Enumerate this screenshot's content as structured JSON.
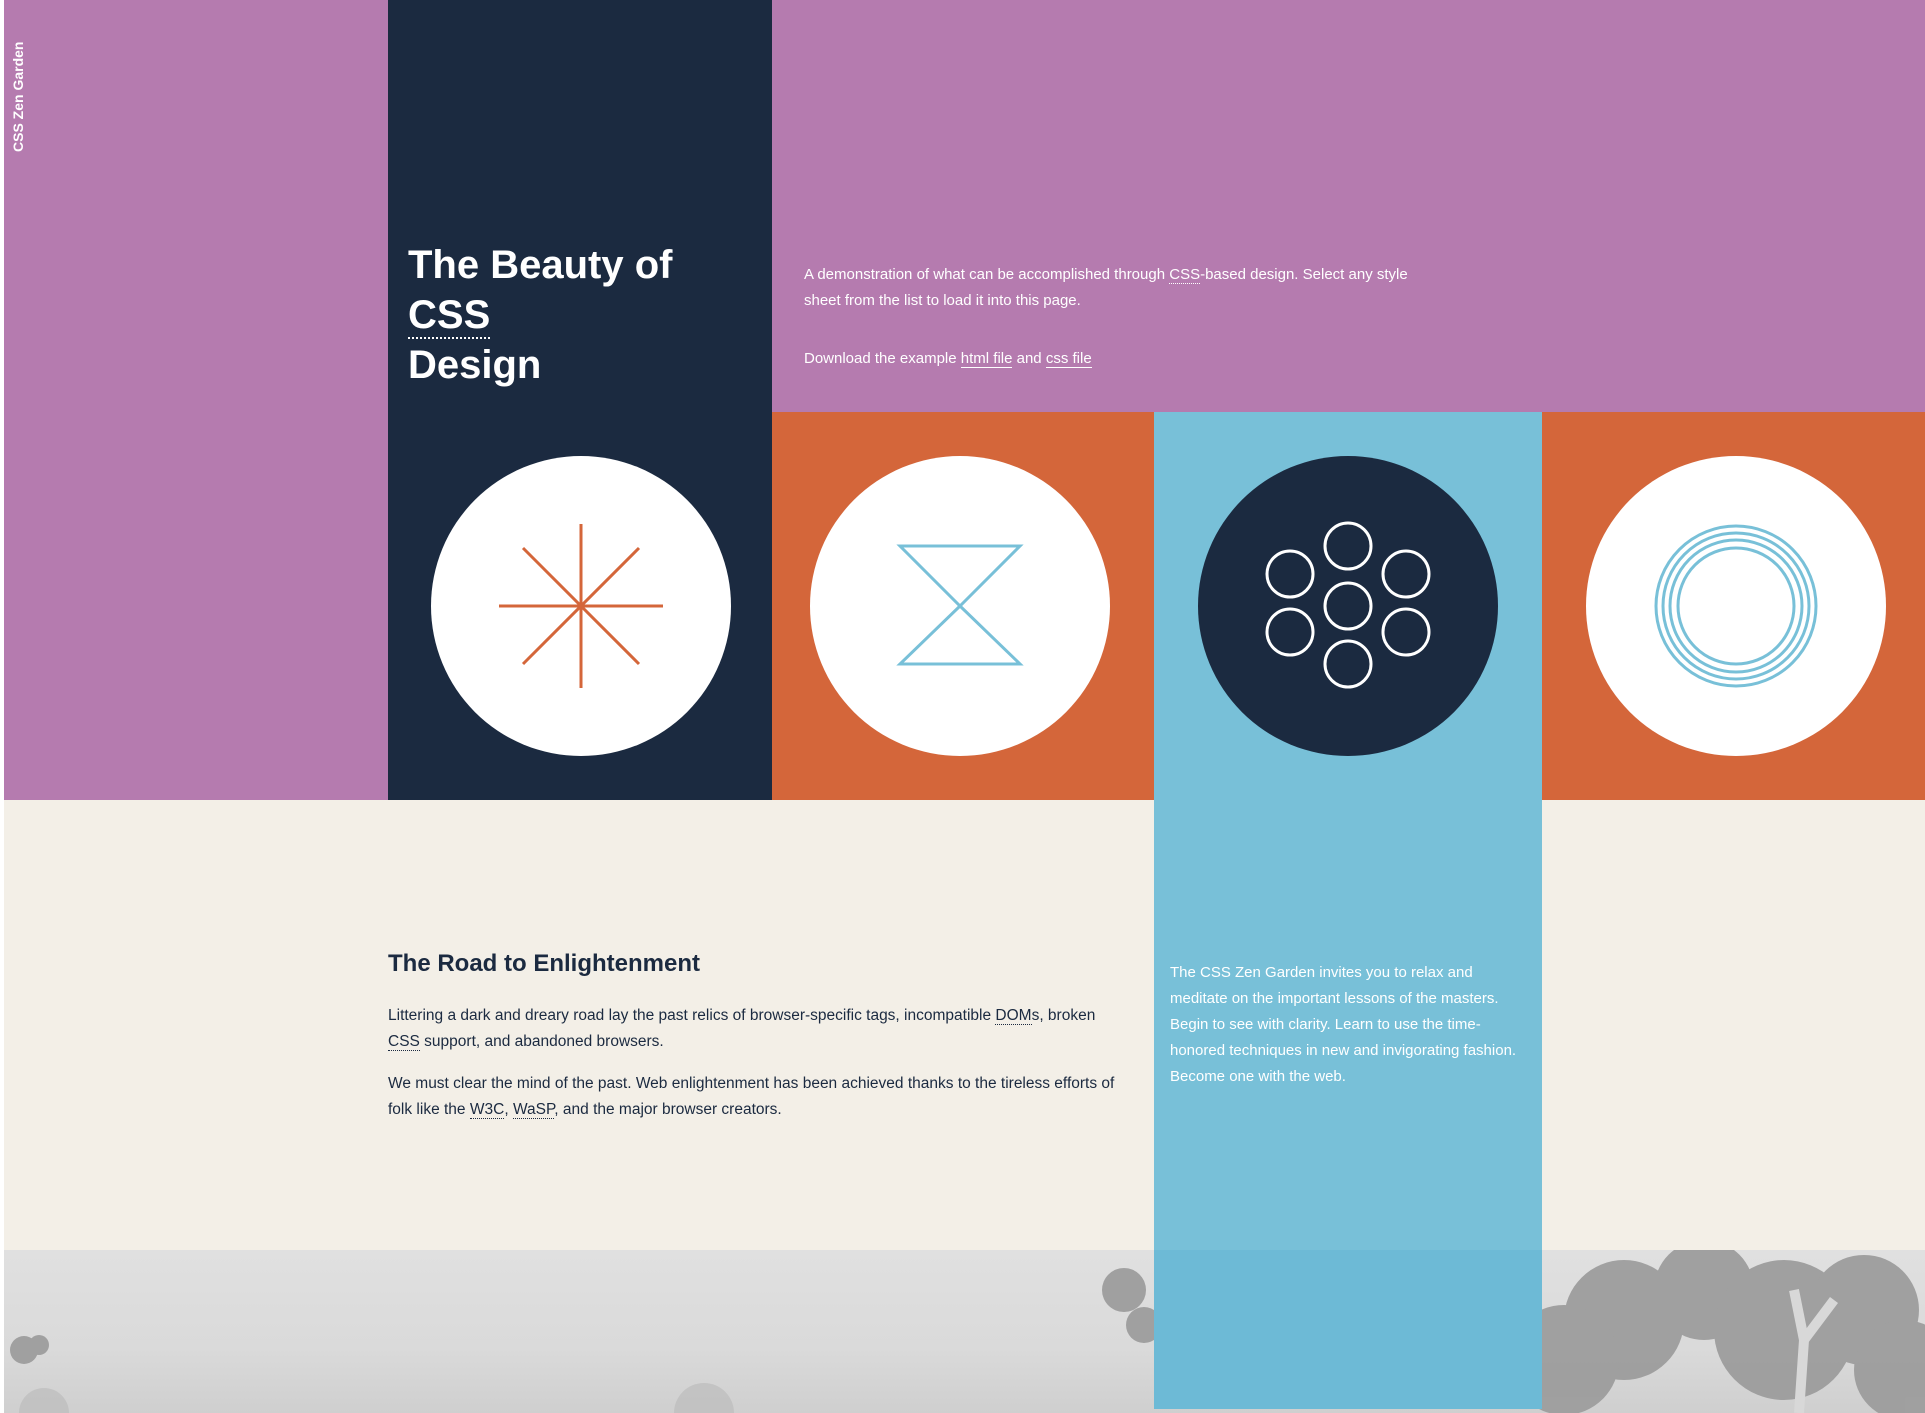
{
  "site": {
    "name": "CSS Zen Garden"
  },
  "hero": {
    "title_prefix": "The Beauty of ",
    "title_abbr": "CSS",
    "title_suffix": "Design"
  },
  "summary": {
    "p1_pre": "A demonstration of what can be accomplished through ",
    "p1_abbr": "CSS",
    "p1_post": "-based design. Select any style sheet from the list to load it into this page.",
    "p2_pre": "Download the example ",
    "html_link": "html file",
    "p2_mid": " and ",
    "css_link": "css file"
  },
  "icons": [
    {
      "name": "asterisk-icon"
    },
    {
      "name": "hourglass-icon"
    },
    {
      "name": "flower-circles-icon"
    },
    {
      "name": "concentric-rings-icon"
    }
  ],
  "road": {
    "title": "The Road to Enlightenment",
    "p1_a": "Littering a dark and dreary road lay the past relics of browser-specific tags, incompatible ",
    "p1_abbr_dom": "DOM",
    "p1_b": "s, broken ",
    "p1_abbr_css": "CSS",
    "p1_c": " support, and abandoned browsers.",
    "p2_a": "We must clear the mind of the past. Web enlightenment has been achieved thanks to the tireless efforts of folk like the ",
    "p2_abbr_w3c": "W3C",
    "p2_b": ", ",
    "p2_abbr_wasp": "WaSP",
    "p2_c": ", and the major browser creators."
  },
  "invite": {
    "text": "The CSS Zen Garden invites you to relax and meditate on the important lessons of the masters. Begin to see with clarity. Learn to use the time-honored techniques in new and invigorating fashion. Become one with the web."
  },
  "colors": {
    "purple": "#b57baf",
    "navy": "#1b2a40",
    "orange": "#d4663a",
    "blue": "#78c0d8",
    "cream": "#f3efe7"
  }
}
